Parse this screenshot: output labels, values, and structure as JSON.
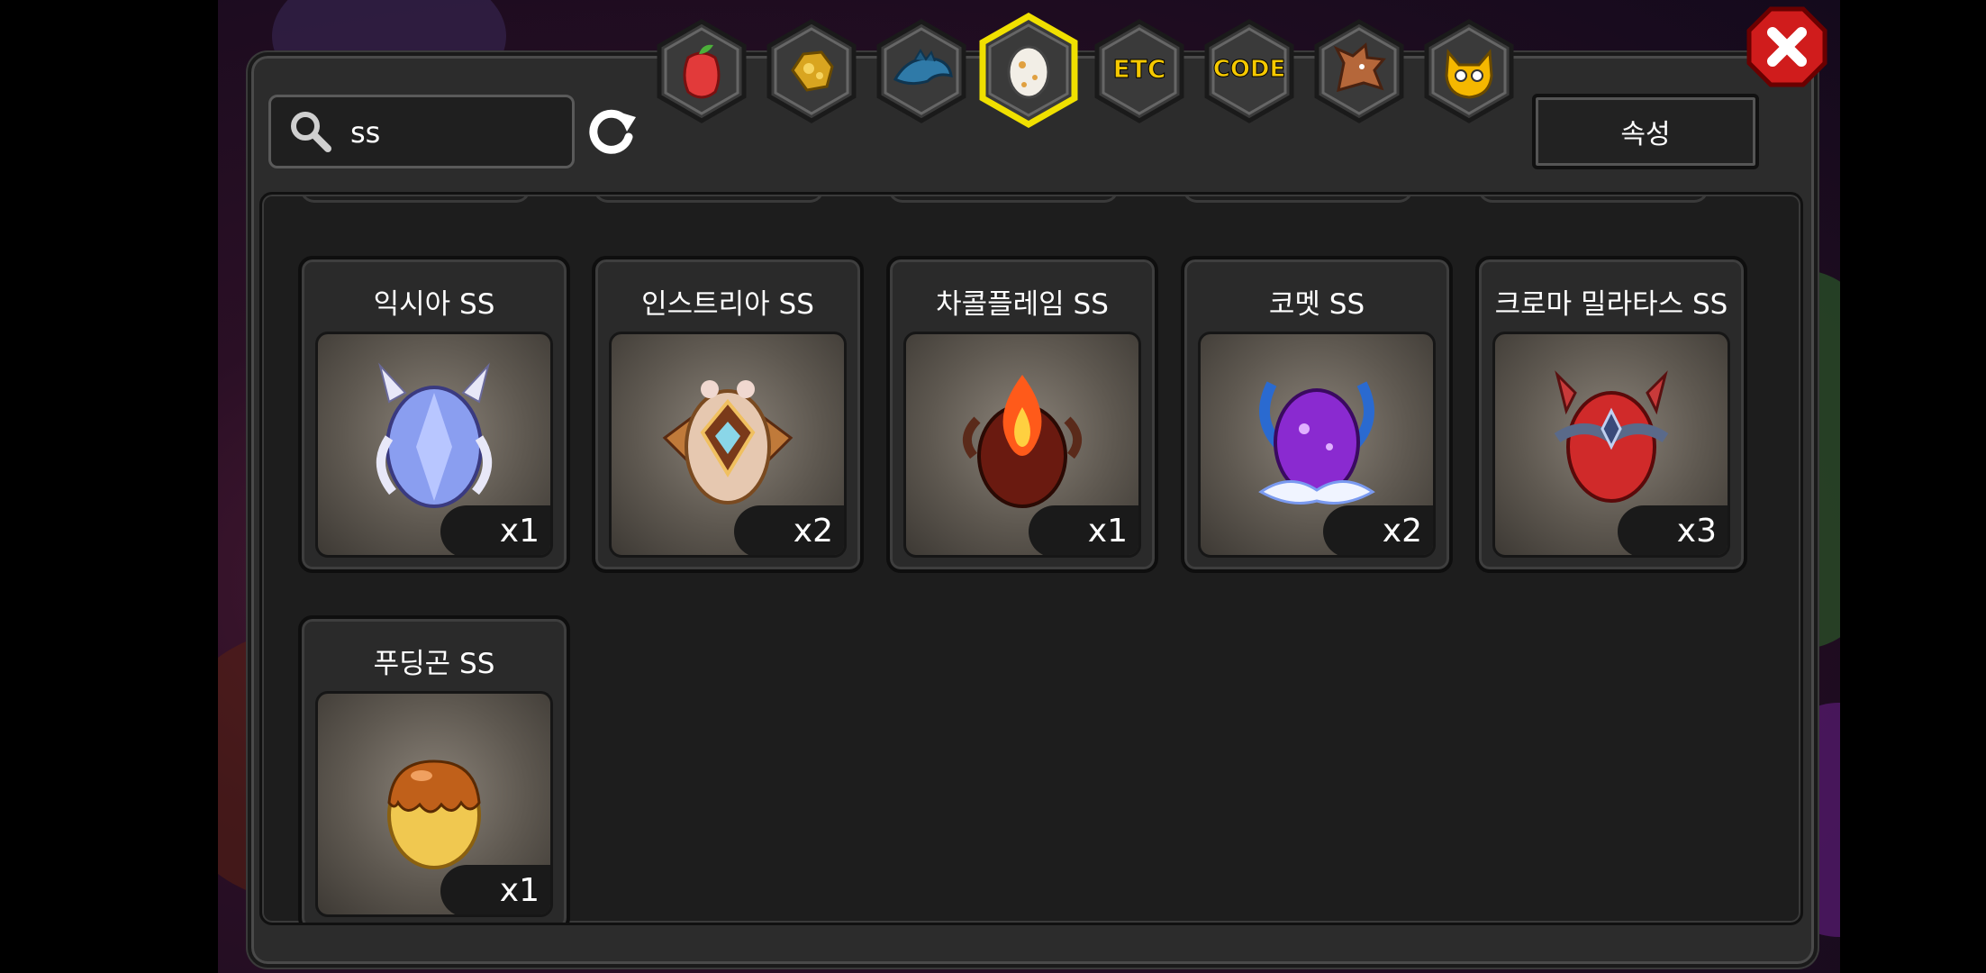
{
  "search": {
    "value": "ss"
  },
  "attribute_button": {
    "label": "속성"
  },
  "tabs": [
    {
      "name": "fruit",
      "icon": "fruit-icon",
      "active": false
    },
    {
      "name": "gold",
      "icon": "gold-nugget-icon",
      "active": false
    },
    {
      "name": "fish",
      "icon": "fish-icon",
      "active": false
    },
    {
      "name": "egg",
      "icon": "egg-icon",
      "active": true
    },
    {
      "name": "etc",
      "label": "ETC",
      "active": false
    },
    {
      "name": "code",
      "label": "CODE",
      "active": false
    },
    {
      "name": "dragon",
      "icon": "dragon-head-icon",
      "active": false
    },
    {
      "name": "mascot",
      "icon": "mascot-icon",
      "active": false
    }
  ],
  "items": [
    {
      "name": "익시아 SS",
      "qty": "x1"
    },
    {
      "name": "인스트리아 SS",
      "qty": "x2"
    },
    {
      "name": "차콜플레임  SS",
      "qty": "x1"
    },
    {
      "name": "코멧 SS",
      "qty": "x2"
    },
    {
      "name": "크로마 밀라타스 SS",
      "qty": "x3"
    },
    {
      "name": "푸딩곤 SS",
      "qty": "x1"
    }
  ],
  "colors": {
    "active_tab_border": "#f0e000",
    "tab_label": "#f5c800",
    "close_red": "#d01c1c"
  }
}
